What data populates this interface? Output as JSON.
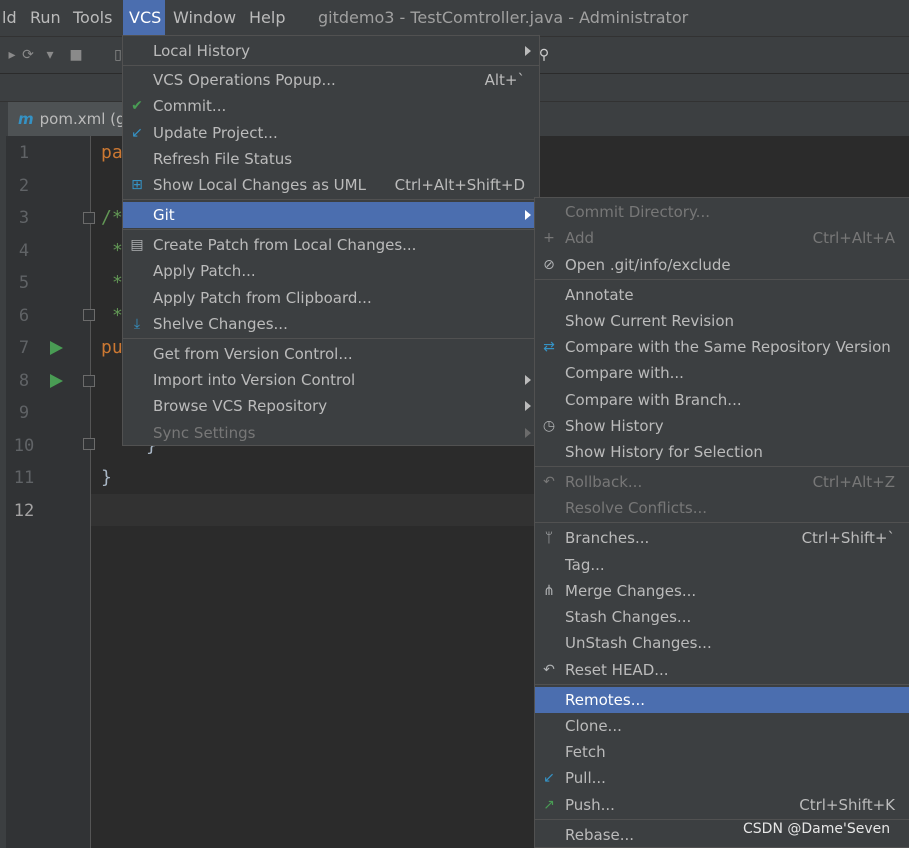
{
  "menubar": {
    "items": [
      "ld",
      "Run",
      "Tools",
      "VCS",
      "Window",
      "Help"
    ],
    "window_title": "gitdemo3 - TestComtroller.java - Administrator"
  },
  "tab": {
    "label": "pom.xml (g",
    "icon_letter": "m"
  },
  "editor": {
    "line_numbers": [
      "1",
      "2",
      "3",
      "4",
      "5",
      "6",
      "7",
      "8",
      "9",
      "10",
      "11",
      "12"
    ],
    "code": {
      "l1": "pa",
      "l3": "/*",
      "l4": "*",
      "l5": "*",
      "l6": "*",
      "l7": "pu",
      "l10": "}",
      "l11": "}"
    }
  },
  "vcs_menu": {
    "local_history": "Local History",
    "vcs_operations_popup": "VCS Operations Popup...",
    "vcs_operations_popup_shortcut": "Alt+`",
    "commit": "Commit...",
    "update_project": "Update Project...",
    "refresh_file_status": "Refresh File Status",
    "show_local_changes_uml": "Show Local Changes as UML",
    "show_local_changes_uml_shortcut": "Ctrl+Alt+Shift+D",
    "git": "Git",
    "create_patch": "Create Patch from Local Changes...",
    "apply_patch": "Apply Patch...",
    "apply_patch_clipboard": "Apply Patch from Clipboard...",
    "shelve_changes": "Shelve Changes...",
    "get_from_vcs": "Get from Version Control...",
    "import_into_vcs": "Import into Version Control",
    "browse_vcs_repo": "Browse VCS Repository",
    "sync_settings": "Sync Settings"
  },
  "git_menu": {
    "commit_directory": "Commit Directory...",
    "add": "Add",
    "add_shortcut": "Ctrl+Alt+A",
    "open_git_exclude": "Open .git/info/exclude",
    "annotate": "Annotate",
    "show_current_revision": "Show Current Revision",
    "compare_same_repo": "Compare with the Same Repository Version",
    "compare_with": "Compare with...",
    "compare_with_branch": "Compare with Branch...",
    "show_history": "Show History",
    "show_history_selection": "Show History for Selection",
    "rollback": "Rollback...",
    "rollback_shortcut": "Ctrl+Alt+Z",
    "resolve_conflicts": "Resolve Conflicts...",
    "branches": "Branches...",
    "branches_shortcut": "Ctrl+Shift+`",
    "tag": "Tag...",
    "merge_changes": "Merge Changes...",
    "stash_changes": "Stash Changes...",
    "unstash_changes": "UnStash Changes...",
    "reset_head": "Reset HEAD...",
    "remotes": "Remotes...",
    "clone": "Clone...",
    "fetch": "Fetch",
    "pull": "Pull...",
    "push": "Push...",
    "push_shortcut": "Ctrl+Shift+K",
    "rebase": "Rebase..."
  },
  "watermark": "CSDN @Dame'Seven",
  "colors": {
    "selection": "#4b6eaf",
    "menu_bg": "#3c3f41",
    "editor_bg": "#2b2b2b",
    "keyword": "#cc7832",
    "comment": "#629755",
    "run_icon": "#499c54"
  }
}
